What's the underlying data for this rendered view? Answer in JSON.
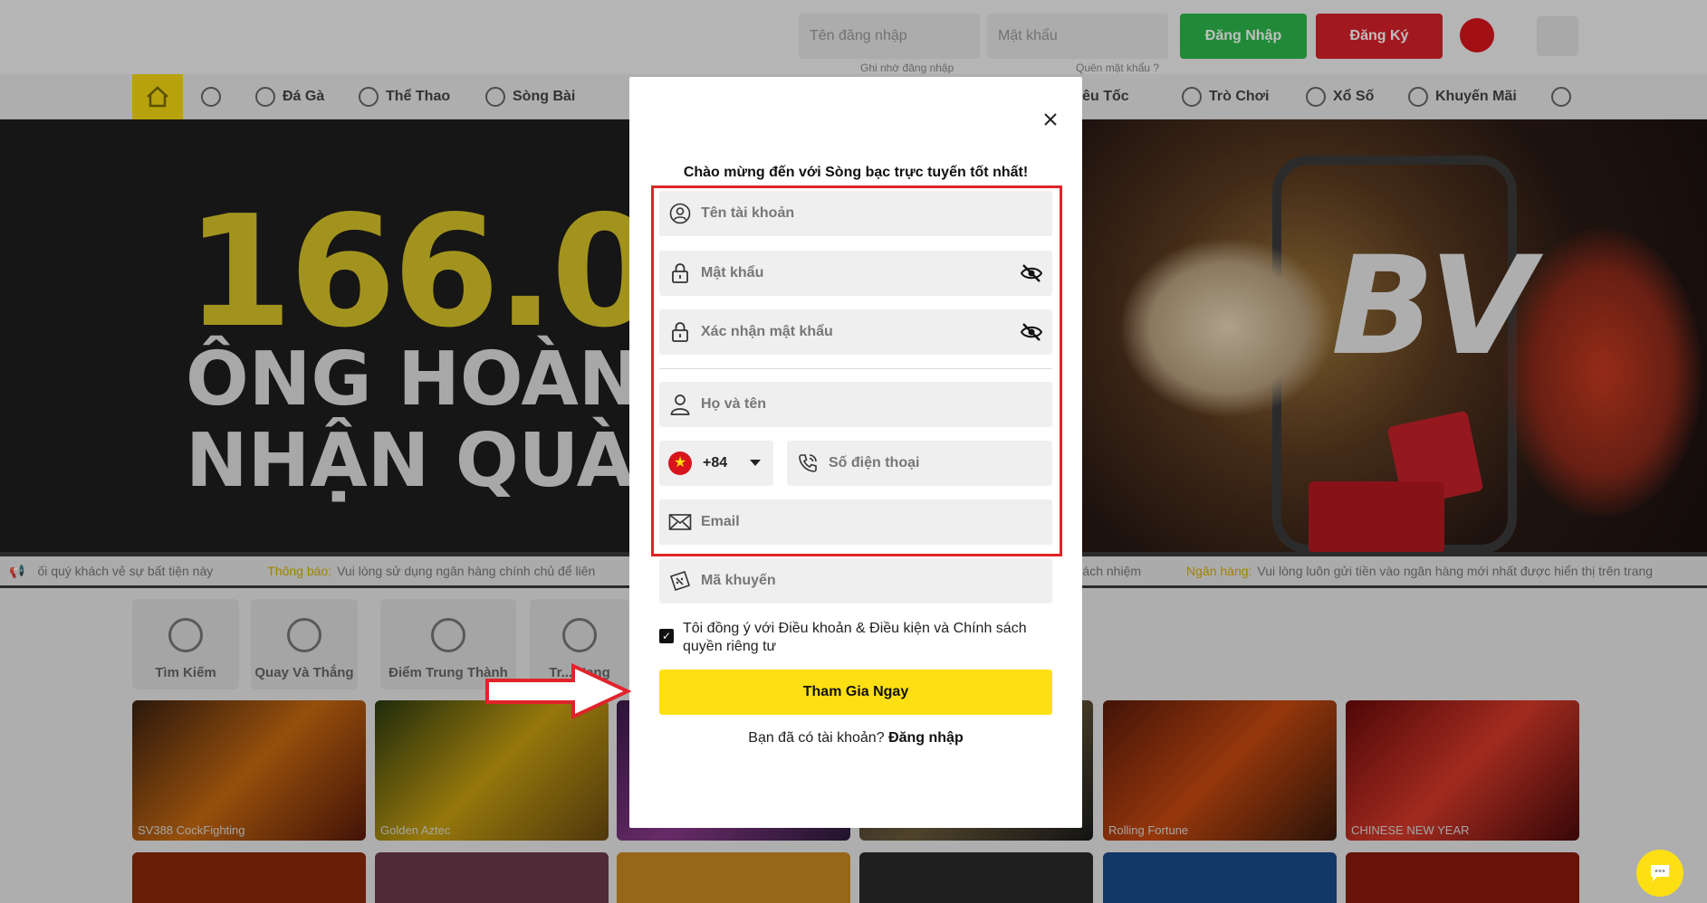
{
  "topbar": {
    "username_placeholder": "Tên đăng nhập",
    "password_placeholder": "Mật khẩu",
    "login_label": "Đăng Nhập",
    "register_label": "Đăng Ký",
    "remember_label": "Ghi nhớ đăng nhập",
    "forgot_label": "Quên mật khẩu ?"
  },
  "nav": {
    "items": [
      "Đá Gà",
      "Thể Thao",
      "Sòng Bài",
      "Siêu Tốc",
      "Trò Chơi",
      "Xổ Số",
      "Khuyến Mãi"
    ]
  },
  "banner": {
    "big_number": "166.00",
    "line2": "ÔNG HOÀNG C",
    "line3": "NHẬN QUÀ CỤ",
    "logo": "BV"
  },
  "ticker": {
    "text1": "ối quý khách vẻ sự bất tiện này",
    "label2": "Thông báo:",
    "text2": "Vui lòng sử dụng ngân hàng chính chủ để liên",
    "text3": "chịu trách nhiệm",
    "label4": "Ngân hàng:",
    "text4": "Vui lòng luôn gửi tiền vào ngân hàng mới nhất được hiển thị trên trang"
  },
  "quick": [
    "Tìm Kiếm",
    "Quay Và Thắng",
    "Điểm Trung Thành",
    "Tr... Hạng"
  ],
  "games": [
    "SV388 CockFighting",
    "Golden Aztec",
    "",
    "",
    "Rolling Fortune",
    "CHINESE NEW YEAR"
  ],
  "modal": {
    "welcome": "Chào mừng đến với Sòng bạc trực tuyến tốt nhất!",
    "account_placeholder": "Tên tài khoản",
    "password_placeholder": "Mật khẩu",
    "confirm_placeholder": "Xác nhận mật khẩu",
    "fullname_placeholder": "Họ và tên",
    "country_code": "+84",
    "phone_placeholder": "Số điện thoại",
    "email_placeholder": "Email",
    "promo_placeholder": "Mã khuyến",
    "agree_text": "Tôi đồng ý với Điều khoản & Điều kiện và Chính sách quyền riêng tư",
    "join_label": "Tham Gia Ngay",
    "have_account": "Bạn đã có tài khoản?",
    "login_link": "Đăng nhập"
  },
  "colors": {
    "accent_yellow": "#fde014",
    "annotation_red": "#e0232b",
    "login_green": "#2db84b",
    "register_red": "#d8202a"
  }
}
